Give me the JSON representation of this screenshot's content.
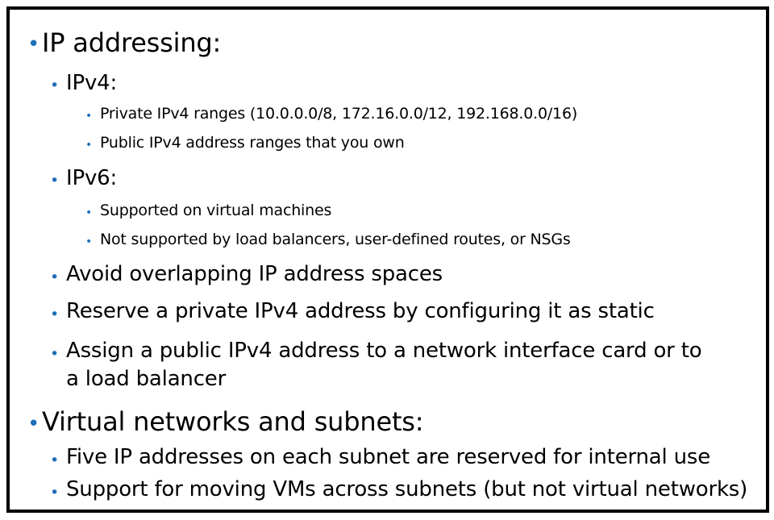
{
  "bullet_color": "#1e6fb8",
  "items": [
    {
      "level": 1,
      "text": "IP addressing:"
    },
    {
      "level": 2,
      "text": "IPv4:"
    },
    {
      "level": 3,
      "text": "Private IPv4 ranges (10.0.0.0/8, 172.16.0.0/12, 192.168.0.0/16)"
    },
    {
      "level": 3,
      "text": "Public IPv4 address ranges that you own"
    },
    {
      "level": 2,
      "text": "IPv6:"
    },
    {
      "level": 3,
      "text": "Supported on virtual machines"
    },
    {
      "level": 3,
      "text": "Not supported by load balancers, user-defined routes, or NSGs"
    },
    {
      "level": 2,
      "text": "Avoid overlapping IP address spaces"
    },
    {
      "level": 2,
      "text": "Reserve a private IPv4 address by configuring it as static"
    },
    {
      "level": 2,
      "text": "Assign a public IPv4 address to a network interface card or to"
    },
    {
      "level": 2,
      "text": "a load balancer",
      "continuation": true
    },
    {
      "level": 1,
      "text": "Virtual networks and subnets:"
    },
    {
      "level": 2,
      "text": "Five IP addresses on each subnet  are reserved for internal use"
    },
    {
      "level": 2,
      "text": "Support for moving VMs across subnets (but not virtual networks)"
    }
  ]
}
